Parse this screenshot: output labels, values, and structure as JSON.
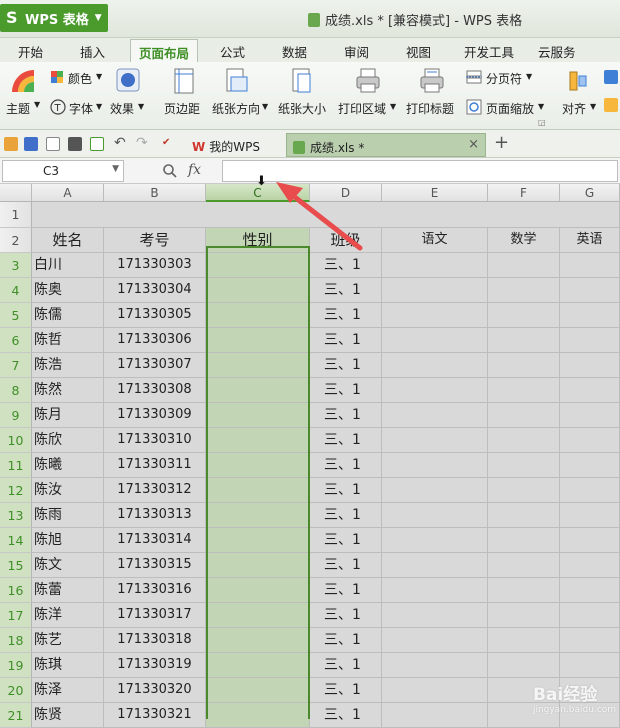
{
  "app": {
    "menu_label": "WPS 表格",
    "window_title": "成绩.xls * [兼容模式] - WPS 表格"
  },
  "tabs": [
    "开始",
    "插入",
    "页面布局",
    "公式",
    "数据",
    "审阅",
    "视图",
    "开发工具",
    "云服务"
  ],
  "active_tab": "页面布局",
  "ribbon": {
    "theme": "主题",
    "colors": "颜色",
    "fonts": "字体",
    "effects": "效果",
    "margins": "页边距",
    "orientation": "纸张方向",
    "size": "纸张大小",
    "print_area": "打印区域",
    "print_titles": "打印标题",
    "page_break": "分页符",
    "page_zoom": "页面缩放",
    "align": "对齐"
  },
  "doc_tabs": {
    "mywps": "我的WPS",
    "file": "成绩.xls *",
    "add": "+"
  },
  "formula_bar": {
    "name_box": "C3",
    "fx": "fx",
    "value": ""
  },
  "columns": [
    "A",
    "B",
    "C",
    "D",
    "E",
    "F",
    "G"
  ],
  "selected_column": "C",
  "header_row": [
    "姓名",
    "考号",
    "性别",
    "班级",
    "语文",
    "数学",
    "英语"
  ],
  "rows": [
    {
      "num": "1",
      "cells": [
        "",
        "",
        "",
        "",
        "",
        "",
        ""
      ]
    },
    {
      "num": "2",
      "cells": [
        "姓名",
        "考号",
        "性别",
        "班级",
        "语文",
        "数学",
        "英语"
      ]
    },
    {
      "num": "3",
      "cells": [
        "白川",
        "171330303",
        "",
        "三、1",
        "",
        "",
        ""
      ]
    },
    {
      "num": "4",
      "cells": [
        "陈奥",
        "171330304",
        "",
        "三、1",
        "",
        "",
        ""
      ]
    },
    {
      "num": "5",
      "cells": [
        "陈儒",
        "171330305",
        "",
        "三、1",
        "",
        "",
        ""
      ]
    },
    {
      "num": "6",
      "cells": [
        "陈哲",
        "171330306",
        "",
        "三、1",
        "",
        "",
        ""
      ]
    },
    {
      "num": "7",
      "cells": [
        "陈浩",
        "171330307",
        "",
        "三、1",
        "",
        "",
        ""
      ]
    },
    {
      "num": "8",
      "cells": [
        "陈然",
        "171330308",
        "",
        "三、1",
        "",
        "",
        ""
      ]
    },
    {
      "num": "9",
      "cells": [
        "陈月",
        "171330309",
        "",
        "三、1",
        "",
        "",
        ""
      ]
    },
    {
      "num": "10",
      "cells": [
        "陈欣",
        "171330310",
        "",
        "三、1",
        "",
        "",
        ""
      ]
    },
    {
      "num": "11",
      "cells": [
        "陈曦",
        "171330311",
        "",
        "三、1",
        "",
        "",
        ""
      ]
    },
    {
      "num": "12",
      "cells": [
        "陈汝",
        "171330312",
        "",
        "三、1",
        "",
        "",
        ""
      ]
    },
    {
      "num": "13",
      "cells": [
        "陈雨",
        "171330313",
        "",
        "三、1",
        "",
        "",
        ""
      ]
    },
    {
      "num": "14",
      "cells": [
        "陈旭",
        "171330314",
        "",
        "三、1",
        "",
        "",
        ""
      ]
    },
    {
      "num": "15",
      "cells": [
        "陈文",
        "171330315",
        "",
        "三、1",
        "",
        "",
        ""
      ]
    },
    {
      "num": "16",
      "cells": [
        "陈蕾",
        "171330316",
        "",
        "三、1",
        "",
        "",
        ""
      ]
    },
    {
      "num": "17",
      "cells": [
        "陈洋",
        "171330317",
        "",
        "三、1",
        "",
        "",
        ""
      ]
    },
    {
      "num": "18",
      "cells": [
        "陈艺",
        "171330318",
        "",
        "三、1",
        "",
        "",
        ""
      ]
    },
    {
      "num": "19",
      "cells": [
        "陈琪",
        "171330319",
        "",
        "三、1",
        "",
        "",
        ""
      ]
    },
    {
      "num": "20",
      "cells": [
        "陈泽",
        "171330320",
        "",
        "三、1",
        "",
        "",
        ""
      ]
    },
    {
      "num": "21",
      "cells": [
        "陈贤",
        "171330321",
        "",
        "三、1",
        "",
        "",
        ""
      ]
    }
  ],
  "colors": {
    "accent": "#4a9a2c",
    "selection": "#c2d6b5",
    "arrow": "#e84c4c"
  },
  "watermark": {
    "brand": "Bai经验",
    "url": "jingyan.baidu.com"
  }
}
